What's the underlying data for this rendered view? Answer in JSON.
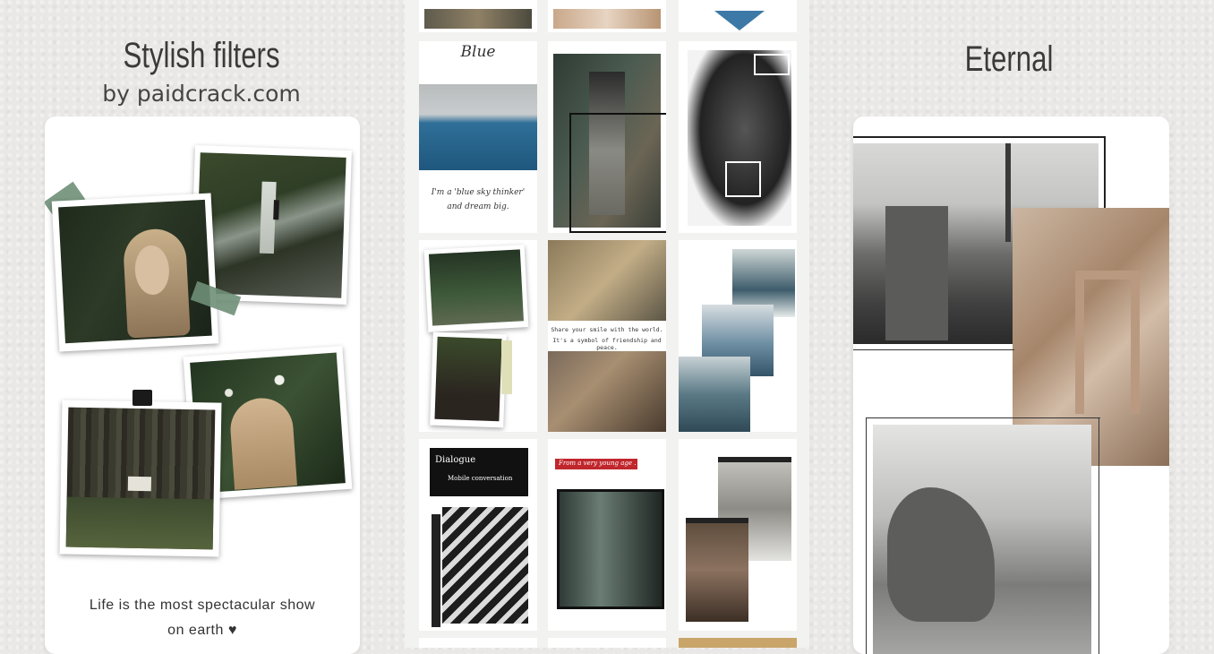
{
  "left_panel": {
    "title": "Stylish filters",
    "subtitle": "by paidcrack.com",
    "caption_line1": "Life is the most spectacular show",
    "caption_line2": "on earth ♥"
  },
  "center_panel": {
    "blue_template_title": "Blue",
    "blue_quote_line1": "I'm a 'blue sky thinker'",
    "blue_quote_line2": "and dream big.",
    "smile_line1": "Share your smile with the world.",
    "smile_line2": "It's a symbol of friendship and peace.",
    "dialogue_title": "Dialogue",
    "dialogue_sub": "Mobile conversation",
    "young_day_label": "From a very young age ."
  },
  "right_panel": {
    "title": "Eternal"
  },
  "colors": {
    "background": "#e9e8e6",
    "tape_green": "#6f8f78",
    "accent_red": "#c0272d"
  }
}
